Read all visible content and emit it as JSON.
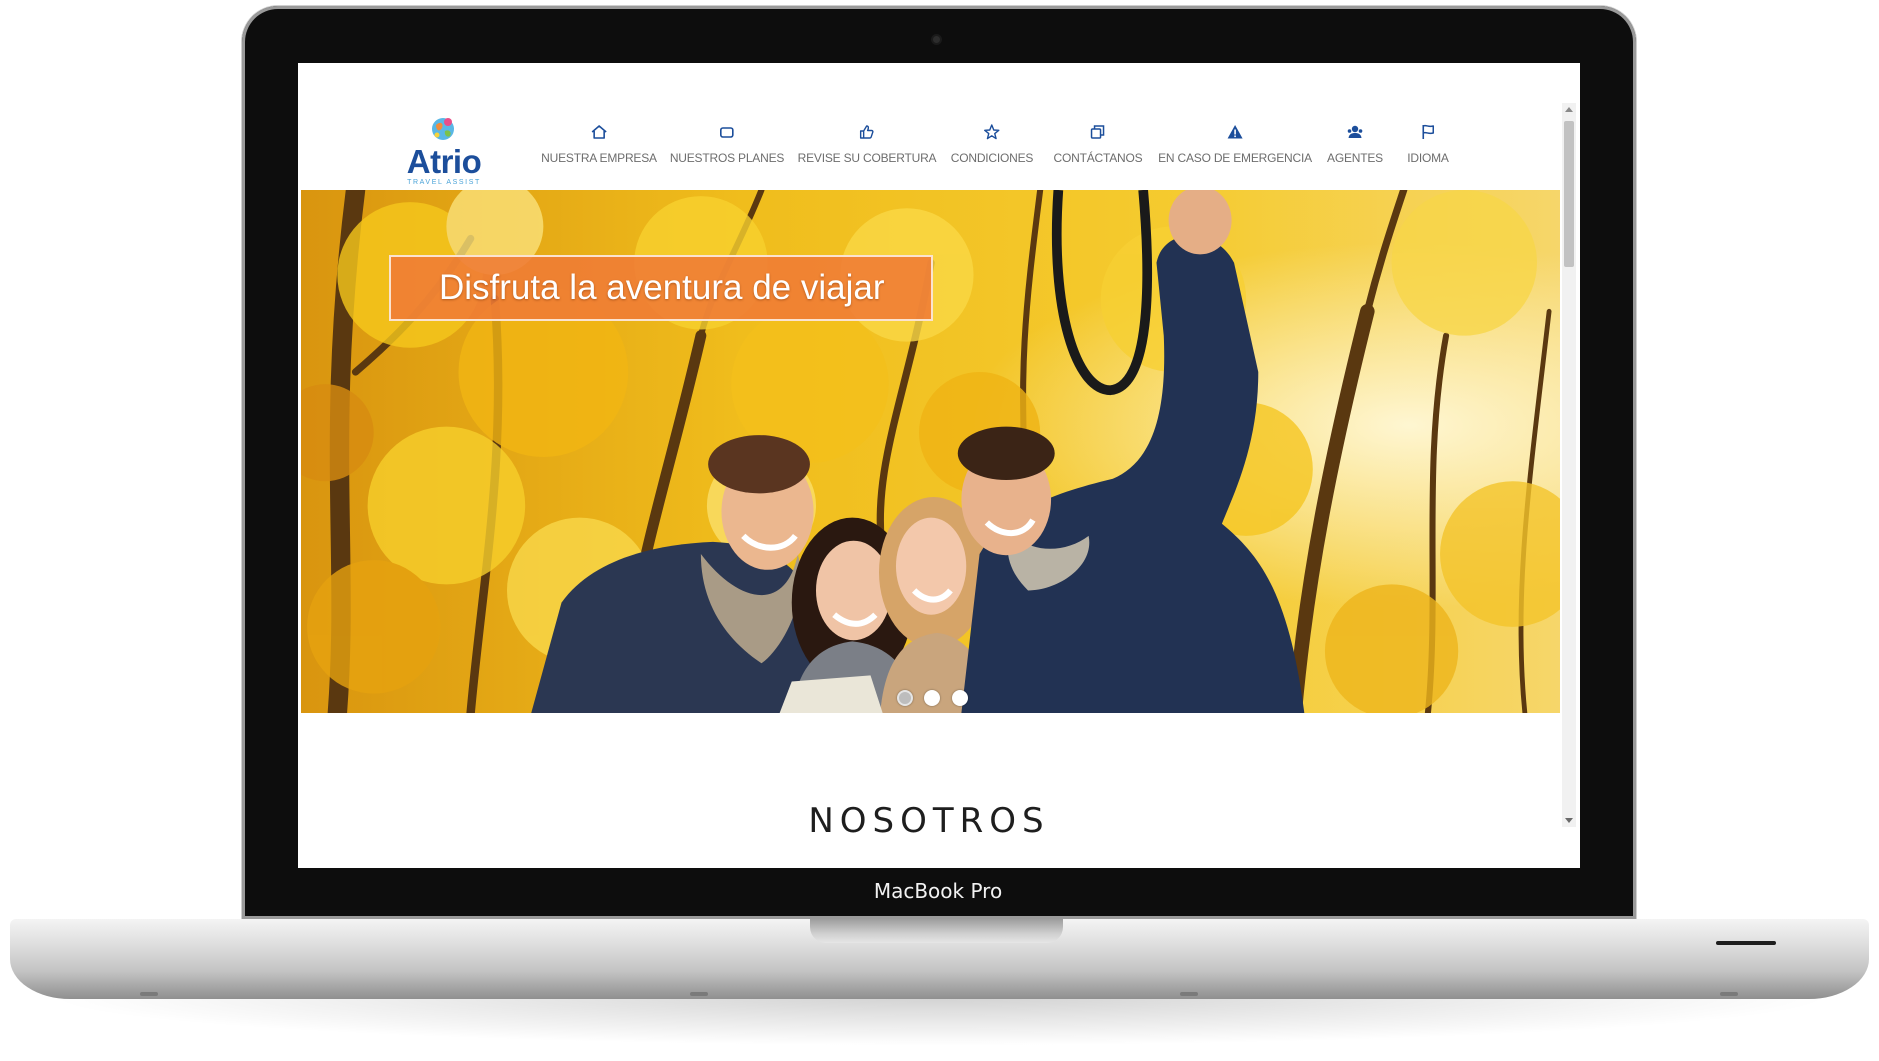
{
  "device": {
    "label": "MacBook Pro"
  },
  "colors": {
    "brand": "#1c4e9b",
    "accent": "#ef7b35"
  },
  "site": {
    "logo": {
      "name": "Atrio",
      "tagline": "TRAVEL ASSIST",
      "icon": "globe-logo-icon"
    },
    "nav": [
      {
        "label": "NUESTRA EMPRESA",
        "icon": "home-icon"
      },
      {
        "label": "NUESTROS PLANES",
        "icon": "square-icon"
      },
      {
        "label": "REVISE SU COBERTURA",
        "icon": "thumbs-up-icon"
      },
      {
        "label": "CONDICIONES",
        "icon": "star-icon"
      },
      {
        "label": "CONTÁCTANOS",
        "icon": "copy-icon"
      },
      {
        "label": "EN CASO DE EMERGENCIA",
        "icon": "warning-icon"
      },
      {
        "label": "AGENTES",
        "icon": "user-group-icon"
      },
      {
        "label": "IDIOMA",
        "icon": "flag-icon"
      }
    ],
    "hero": {
      "caption": "Disfruta la aventura de viajar",
      "slide_count": 3,
      "active_slide": 1
    },
    "section_title": "NOSOTROS"
  }
}
